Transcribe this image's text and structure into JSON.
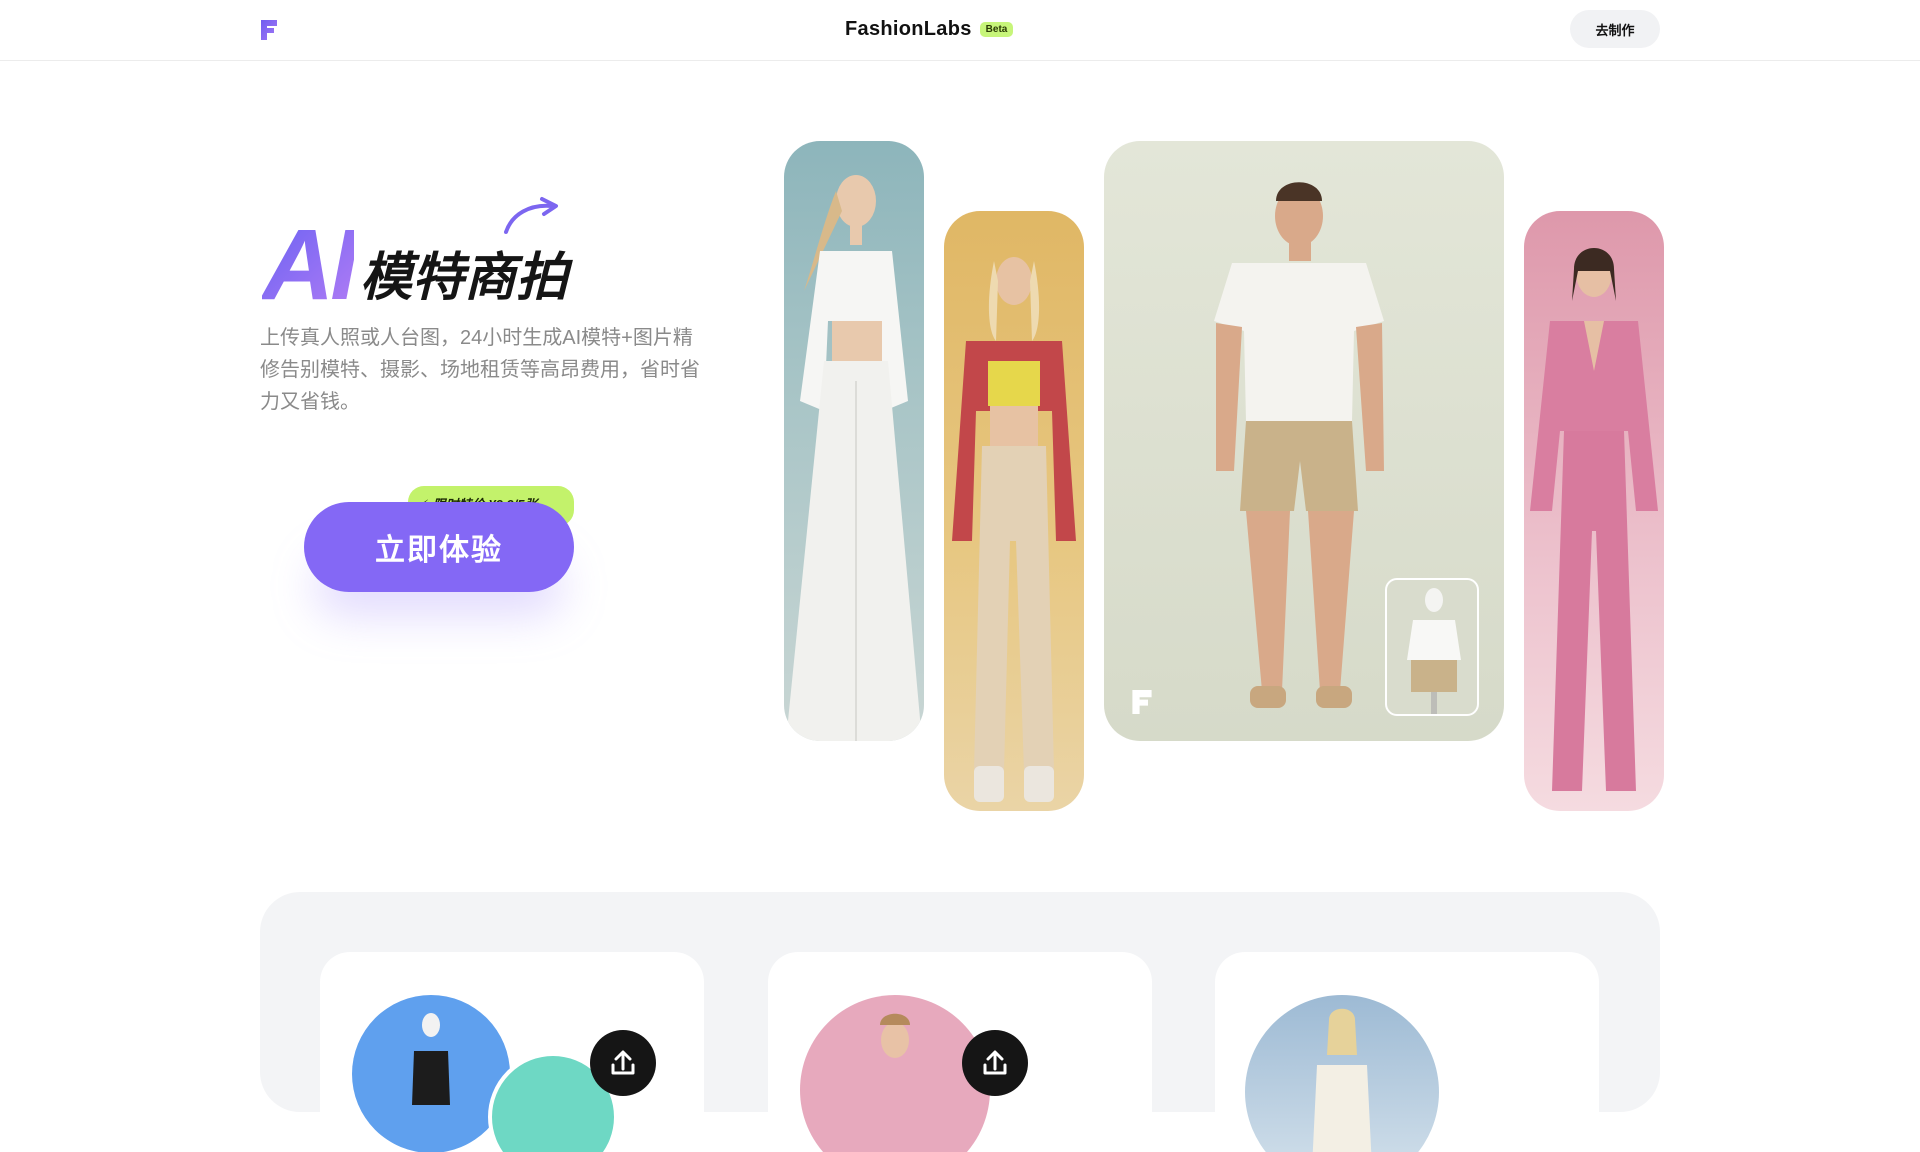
{
  "header": {
    "brand_name": "FashionLabs",
    "beta_badge": "Beta",
    "make_button": "去制作",
    "logo_icon": "fashionlabs-f-logo"
  },
  "hero": {
    "title_ai": "AI",
    "title_cn": "模特商拍",
    "description": "上传真人照或人台图，24小时生成AI模特+图片精修告别模特、摄影、场地租赁等高昂费用，省时省力又省钱。",
    "promo_badge": "⚡ 限时特价 ¥9.9/5张",
    "cta_button": "立即体验",
    "accent_color": "#8468f5",
    "promo_color": "#c3f26b"
  },
  "gallery": {
    "images": [
      {
        "name": "model-white-outfit"
      },
      {
        "name": "model-plaid-shirt"
      },
      {
        "name": "model-white-tee-shorts"
      },
      {
        "name": "model-pink-suit"
      }
    ]
  },
  "features": {
    "cards": [
      {
        "name": "mannequin-to-model",
        "icon": "upload-icon"
      },
      {
        "name": "model-pose-upload",
        "icon": "upload-icon"
      },
      {
        "name": "model-scene"
      }
    ]
  }
}
